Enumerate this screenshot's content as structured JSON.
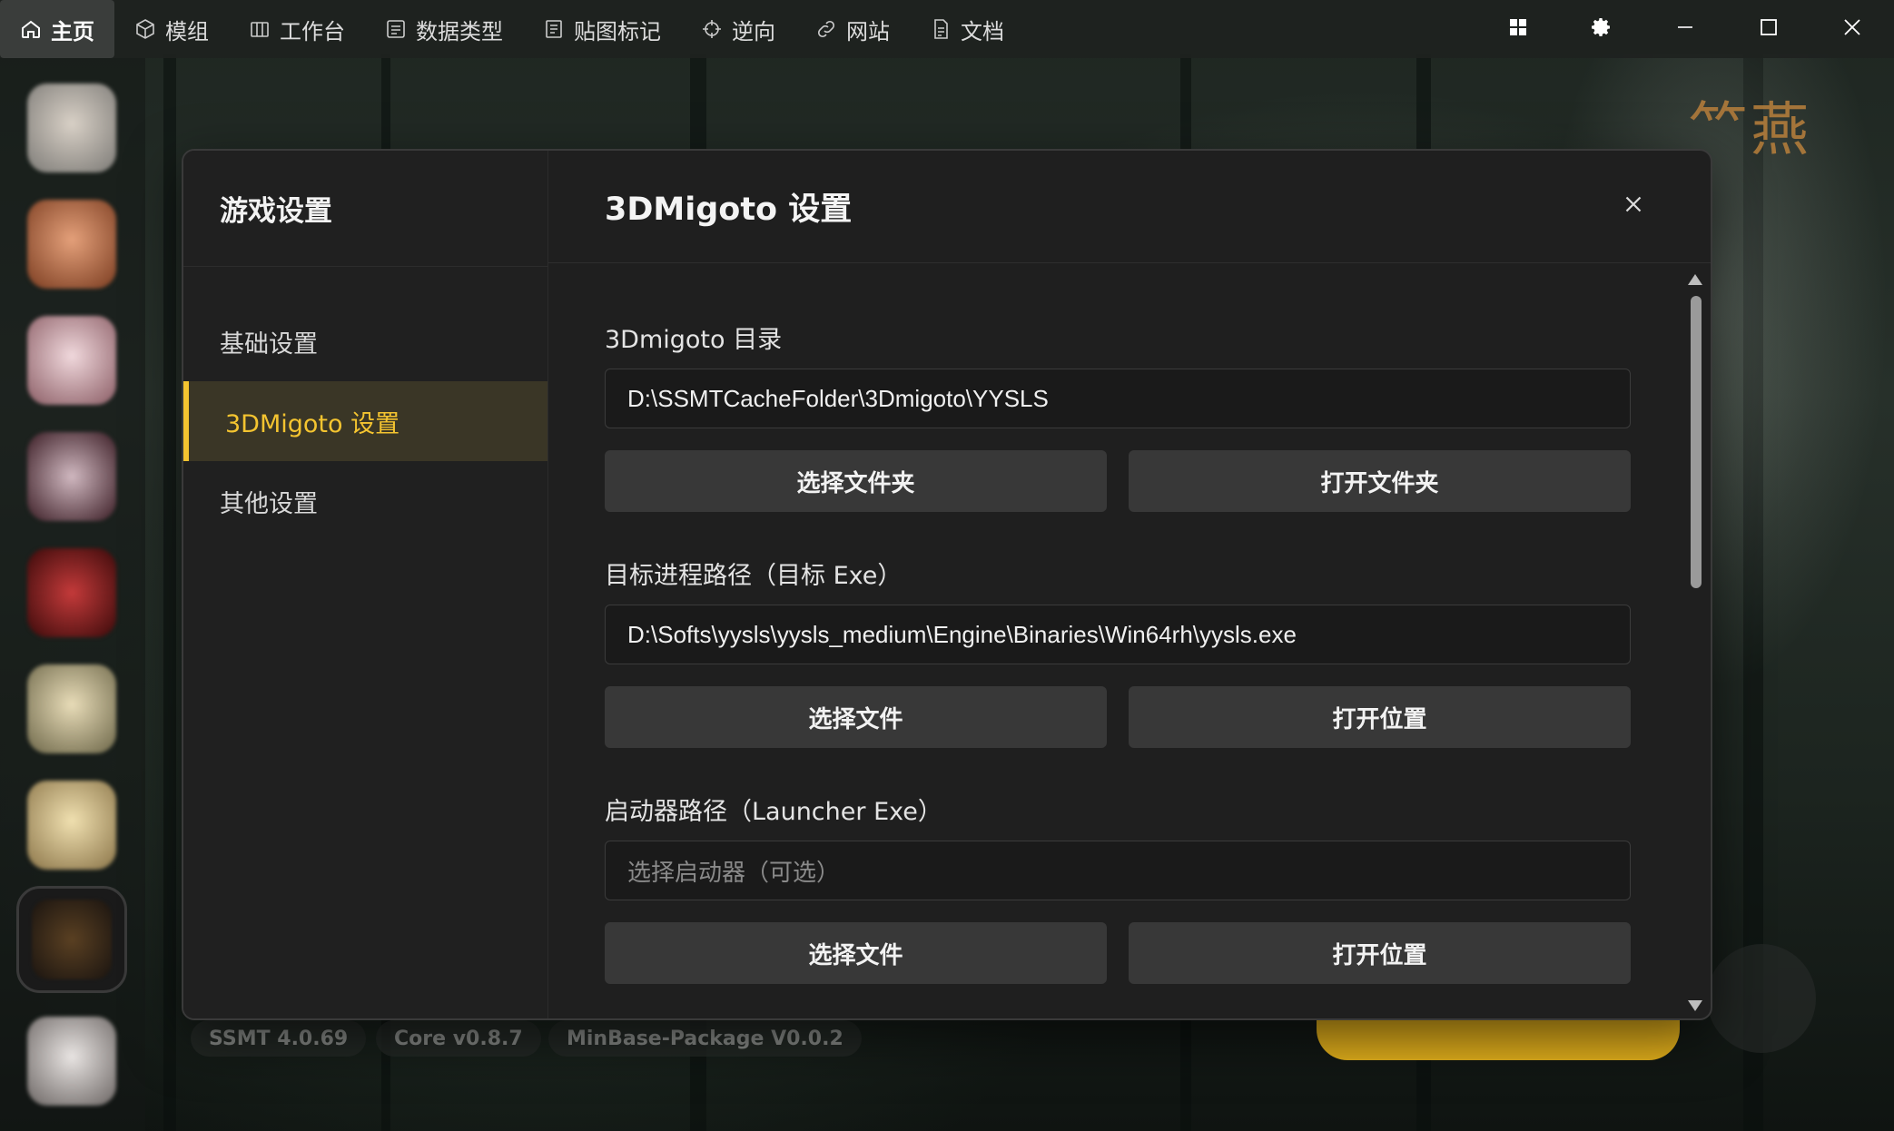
{
  "nav": {
    "tabs": [
      {
        "label": "主页",
        "icon": "home-icon"
      },
      {
        "label": "模组",
        "icon": "cube-icon"
      },
      {
        "label": "工作台",
        "icon": "workbench-icon"
      },
      {
        "label": "数据类型",
        "icon": "list-icon"
      },
      {
        "label": "贴图标记",
        "icon": "texture-icon"
      },
      {
        "label": "逆向",
        "icon": "crosshair-icon"
      },
      {
        "label": "网站",
        "icon": "link-icon"
      },
      {
        "label": "文档",
        "icon": "document-icon"
      }
    ],
    "active_tab": "主页"
  },
  "window_controls": [
    "grid-icon",
    "settings-icon",
    "minimize-icon",
    "maximize-icon",
    "close-icon"
  ],
  "footer": {
    "versions": [
      "SSMT 4.0.69",
      "Core v0.8.7",
      "MinBase-Package V0.0.2"
    ]
  },
  "dialog": {
    "left_title": "游戏设置",
    "nav_items": [
      "基础设置",
      "3DMigoto 设置",
      "其他设置"
    ],
    "active_nav": "3DMigoto 设置",
    "header_title": "3DMigoto 设置",
    "fields": [
      {
        "label": "3Dmigoto 目录",
        "value": "D:\\SSMTCacheFolder\\3Dmigoto\\YYSLS",
        "placeholder": "",
        "buttons": [
          "选择文件夹",
          "打开文件夹"
        ]
      },
      {
        "label": "目标进程路径（目标 Exe）",
        "value": "D:\\Softs\\yysls\\yysls_medium\\Engine\\Binaries\\Win64rh\\yysls.exe",
        "placeholder": "",
        "buttons": [
          "选择文件",
          "打开位置"
        ]
      },
      {
        "label": "启动器路径（Launcher Exe）",
        "value": "",
        "placeholder": "选择启动器（可选）",
        "buttons": [
          "选择文件",
          "打开位置"
        ]
      }
    ]
  },
  "colors": {
    "accent": "#f4c430",
    "dialog_bg": "#1f1f1f",
    "button_bg": "#383838"
  }
}
